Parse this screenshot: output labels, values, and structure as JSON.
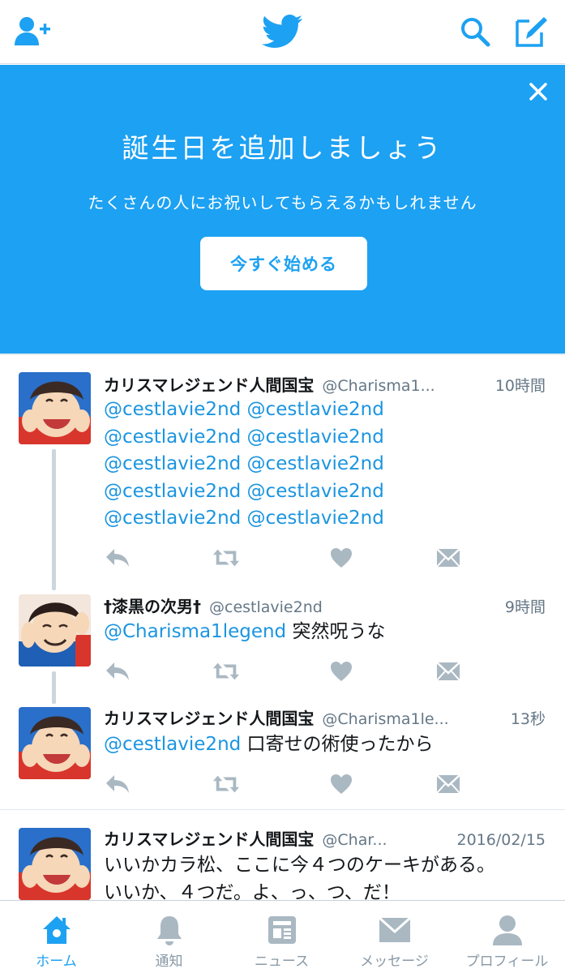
{
  "colors": {
    "accent": "#1da1f2",
    "link": "#1b95e0",
    "icon_gray": "#aab8c2",
    "text_secondary": "#657786"
  },
  "topbar": {
    "icons": [
      "add-user-icon",
      "twitter-bird-icon",
      "search-icon",
      "compose-icon"
    ]
  },
  "banner": {
    "title": "誕生日を追加しましょう",
    "subtitle": "たくさんの人にお祝いしてもらえるかもしれません",
    "cta_label": "今すぐ始める",
    "close_icon": "close-icon"
  },
  "tweets": [
    {
      "name": "カリスマレジェンド人間国宝",
      "handle": "@Charisma1...",
      "time": "10時間",
      "lines": [
        "@cestlavie2nd @cestlavie2nd",
        "@cestlavie2nd @cestlavie2nd",
        "@cestlavie2nd @cestlavie2nd",
        "@cestlavie2nd @cestlavie2nd",
        "@cestlavie2nd @cestlavie2nd"
      ]
    },
    {
      "name": "†漆黒の次男†",
      "handle": "@cestlavie2nd",
      "time": "9時間",
      "mention": "@Charisma1legend",
      "text": " 突然呪うな"
    },
    {
      "name": "カリスマレジェンド人間国宝",
      "handle": "@Charisma1le...",
      "time": "13秒",
      "mention": "@cestlavie2nd",
      "text": " 口寄せの術使ったから"
    },
    {
      "name": "カリスマレジェンド人間国宝",
      "handle": "@Char...",
      "time": "2016/02/15",
      "line1": "いいかカラ松、ここに今４つのケーキがある。",
      "line2": "いいか、４つだ。よ、っ、つ、だ！"
    }
  ],
  "tabbar": {
    "tabs": [
      {
        "label": "ホーム",
        "icon": "home-icon",
        "active": true
      },
      {
        "label": "通知",
        "icon": "bell-icon",
        "active": false
      },
      {
        "label": "ニュース",
        "icon": "news-icon",
        "active": false
      },
      {
        "label": "メッセージ",
        "icon": "envelope-icon",
        "active": false
      },
      {
        "label": "プロフィール",
        "icon": "profile-icon",
        "active": false
      }
    ]
  }
}
